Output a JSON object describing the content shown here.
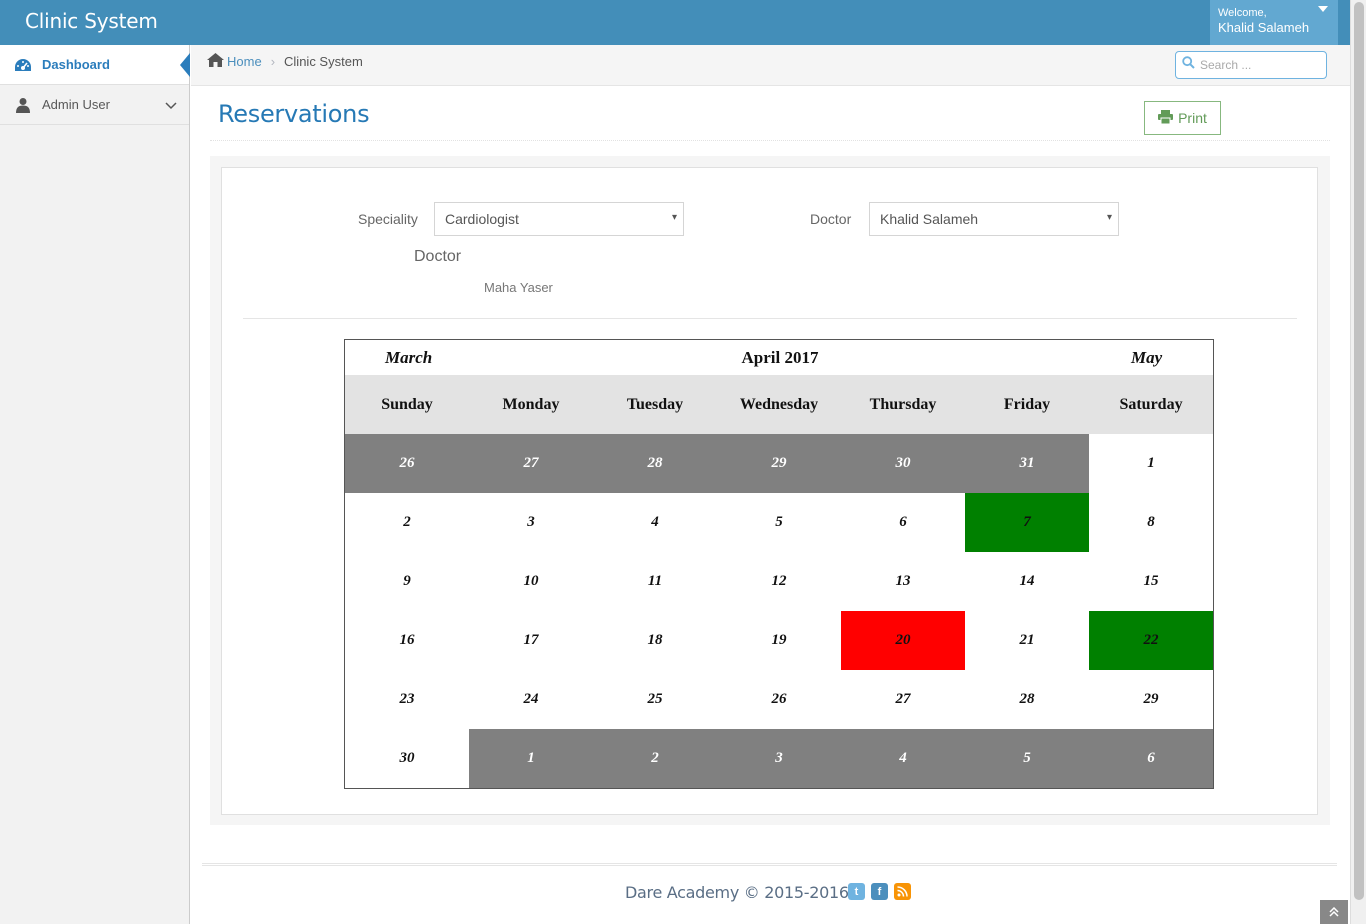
{
  "navbar": {
    "brand": "Clinic System",
    "welcome": "Welcome,",
    "user_name": "Khalid Salameh"
  },
  "sidebar": {
    "items": [
      {
        "label": "Dashboard",
        "icon": "tachometer-icon",
        "active": true
      },
      {
        "label": "Admin User",
        "icon": "user-icon",
        "active": false
      }
    ]
  },
  "breadcrumb": {
    "home": "Home",
    "current": "Clinic System"
  },
  "search": {
    "placeholder": "Search ..."
  },
  "page": {
    "title": "Reservations",
    "print_label": "Print"
  },
  "filters": {
    "speciality_label": "Speciality",
    "speciality_value": "Cardiologist",
    "doctor_label": "Doctor",
    "doctor_value": "Khalid Salameh"
  },
  "doctor_section": {
    "heading": "Doctor",
    "name": "Maha Yaser"
  },
  "calendar": {
    "prev_month": "March",
    "month": "April 2017",
    "next_month": "May",
    "weekdays": [
      "Sunday",
      "Monday",
      "Tuesday",
      "Wednesday",
      "Thursday",
      "Friday",
      "Saturday"
    ],
    "weeks": [
      [
        {
          "d": "26",
          "s": "other"
        },
        {
          "d": "27",
          "s": "other"
        },
        {
          "d": "28",
          "s": "other"
        },
        {
          "d": "29",
          "s": "other"
        },
        {
          "d": "30",
          "s": "other"
        },
        {
          "d": "31",
          "s": "other"
        },
        {
          "d": "1",
          "s": ""
        }
      ],
      [
        {
          "d": "2",
          "s": ""
        },
        {
          "d": "3",
          "s": ""
        },
        {
          "d": "4",
          "s": ""
        },
        {
          "d": "5",
          "s": ""
        },
        {
          "d": "6",
          "s": ""
        },
        {
          "d": "7",
          "s": "green"
        },
        {
          "d": "8",
          "s": ""
        }
      ],
      [
        {
          "d": "9",
          "s": ""
        },
        {
          "d": "10",
          "s": ""
        },
        {
          "d": "11",
          "s": ""
        },
        {
          "d": "12",
          "s": ""
        },
        {
          "d": "13",
          "s": ""
        },
        {
          "d": "14",
          "s": ""
        },
        {
          "d": "15",
          "s": ""
        }
      ],
      [
        {
          "d": "16",
          "s": ""
        },
        {
          "d": "17",
          "s": ""
        },
        {
          "d": "18",
          "s": ""
        },
        {
          "d": "19",
          "s": ""
        },
        {
          "d": "20",
          "s": "red"
        },
        {
          "d": "21",
          "s": ""
        },
        {
          "d": "22",
          "s": "green"
        }
      ],
      [
        {
          "d": "23",
          "s": ""
        },
        {
          "d": "24",
          "s": ""
        },
        {
          "d": "25",
          "s": ""
        },
        {
          "d": "26",
          "s": ""
        },
        {
          "d": "27",
          "s": ""
        },
        {
          "d": "28",
          "s": ""
        },
        {
          "d": "29",
          "s": ""
        }
      ],
      [
        {
          "d": "30",
          "s": ""
        },
        {
          "d": "1",
          "s": "other"
        },
        {
          "d": "2",
          "s": "other"
        },
        {
          "d": "3",
          "s": "other"
        },
        {
          "d": "4",
          "s": "other"
        },
        {
          "d": "5",
          "s": "other"
        },
        {
          "d": "6",
          "s": "other"
        }
      ]
    ]
  },
  "footer": {
    "text": "Dare Academy © 2015-2016",
    "social": [
      "twitter-icon",
      "facebook-icon",
      "rss-icon"
    ]
  },
  "colors": {
    "navbar": "#438eb9",
    "available": "#008000",
    "booked": "#ff0000",
    "other_month": "#808080"
  }
}
